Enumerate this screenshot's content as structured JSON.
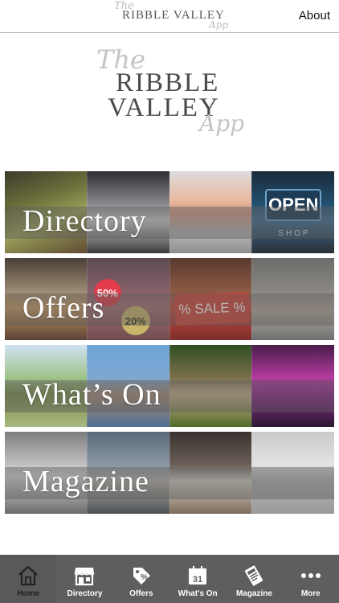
{
  "header": {
    "logo_the": "The",
    "logo_main": "RIBBLE VALLEY",
    "logo_app": "App",
    "about_label": "About"
  },
  "hero_logo": {
    "the": "The",
    "line1": "RIBBLE",
    "line2": "VALLEY",
    "app": "App"
  },
  "banners": [
    {
      "label": "Directory"
    },
    {
      "label": "Offers"
    },
    {
      "label": "What’s On"
    },
    {
      "label": "Magazine"
    }
  ],
  "banner_decor": {
    "badge_50": "50%",
    "badge_20": "20%",
    "sale": "% SALE %",
    "open": "OPEN",
    "shop": "SHOP"
  },
  "tabbar": {
    "items": [
      {
        "label": "Home",
        "icon": "home-icon"
      },
      {
        "label": "Directory",
        "icon": "shop-icon"
      },
      {
        "label": "Offers",
        "icon": "offer-tag-icon"
      },
      {
        "label": "What's On",
        "icon": "calendar-icon",
        "icon_text": "31"
      },
      {
        "label": "Magazine",
        "icon": "magazine-icon"
      },
      {
        "label": "More",
        "icon": "more-dots-icon"
      }
    ]
  },
  "colors": {
    "tabbar_bg": "#5e5e5e",
    "banner_text": "#ffffff",
    "logo_script": "#c4c4c4",
    "logo_main": "#4a4a4a"
  }
}
